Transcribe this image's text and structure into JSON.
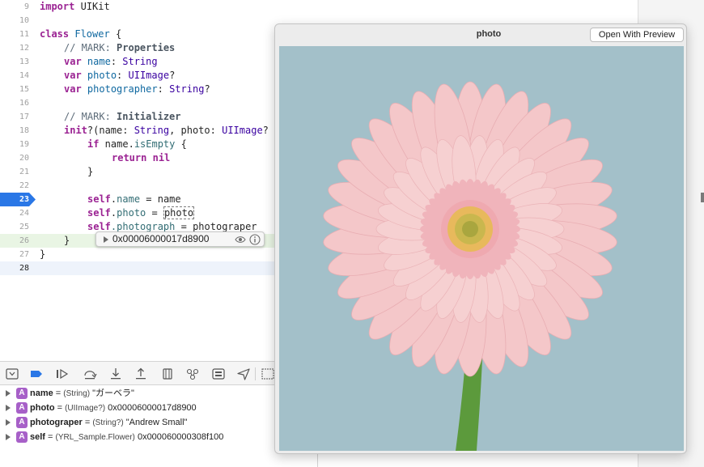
{
  "editor": {
    "lines": [
      {
        "num": "9"
      },
      {
        "num": "10"
      },
      {
        "num": "11"
      },
      {
        "num": "12"
      },
      {
        "num": "13"
      },
      {
        "num": "14"
      },
      {
        "num": "15"
      },
      {
        "num": "16"
      },
      {
        "num": "17"
      },
      {
        "num": "18"
      },
      {
        "num": "19"
      },
      {
        "num": "20"
      },
      {
        "num": "21"
      },
      {
        "num": "22"
      },
      {
        "num": "23"
      },
      {
        "num": "24"
      },
      {
        "num": "25"
      },
      {
        "num": "26"
      },
      {
        "num": "27"
      },
      {
        "num": "28"
      }
    ],
    "tokens": {
      "import_kw": "import",
      "uikit": "UIKit",
      "class_kw": "class",
      "flower": "Flower",
      "brace_open": " {",
      "mark1_prefix": "// MARK: ",
      "mark1_title": "Properties",
      "var_kw": "var",
      "name_prop": "name",
      "string_ty": "String",
      "photo_prop": "photo",
      "uiimage_ty": "UIImage",
      "q": "?",
      "photographer_prop": "photographer",
      "mark2_prefix": "// MARK: ",
      "mark2_title": "Initializer",
      "init_kw": "init",
      "init_args_1": "?(name: ",
      "init_args_2": ", photo: ",
      "init_args_3": "?",
      "if_kw": "if",
      "if_cond_1": " name.",
      "is_empty": "isEmpty",
      "if_cond_2": " {",
      "return_kw": "return",
      "nil_kw": "nil",
      "close_brace": "}",
      "self_kw": "self",
      "assign_name_1": ".",
      "assign_name_2": " = name",
      "assign_photo_2": " = ",
      "assign_photo_val": "photo",
      "assign_pg_1": ".photograph",
      "assign_pg_2": " = photograper",
      "colon": ": "
    }
  },
  "breakpoint": {
    "line": "23",
    "color": "#2a77e6"
  },
  "datatip": {
    "value": "0x00006000017d8900",
    "icons": [
      "disclosure-triangle",
      "eye-icon",
      "info-icon"
    ]
  },
  "debugbar": {
    "buttons": [
      "hide-debug-area-icon",
      "breakpoints-toggle-icon",
      "continue-icon",
      "step-over-icon",
      "step-into-icon",
      "step-out-icon",
      "debug-view-hierarchy-icon",
      "memory-graph-icon",
      "environment-overrides-icon",
      "simulate-location-icon",
      "frame-icon"
    ]
  },
  "variables": [
    {
      "badge": "A",
      "name": "name",
      "eq": " = ",
      "type": "(String)",
      "value": " \"ガーベラ\""
    },
    {
      "badge": "A",
      "name": "photo",
      "eq": " = ",
      "type": "(UIImage?)",
      "value": " 0x00006000017d8900"
    },
    {
      "badge": "A",
      "name": "photograper",
      "eq": " = ",
      "type": "(String?)",
      "value": " \"Andrew Small\""
    },
    {
      "badge": "A",
      "name": "self",
      "eq": " = ",
      "type": "(YRL_Sample.Flower)",
      "value": " 0x000060000308f100"
    }
  ],
  "quicklook": {
    "title": "photo",
    "open_button": "Open With Preview",
    "image": "pink-gerbera-daisy-photo",
    "background_color": "#a3c0c9",
    "petal_color": "#f4c7c9",
    "center_color": "#c9b74e",
    "stem_color": "#5c9a3c"
  }
}
